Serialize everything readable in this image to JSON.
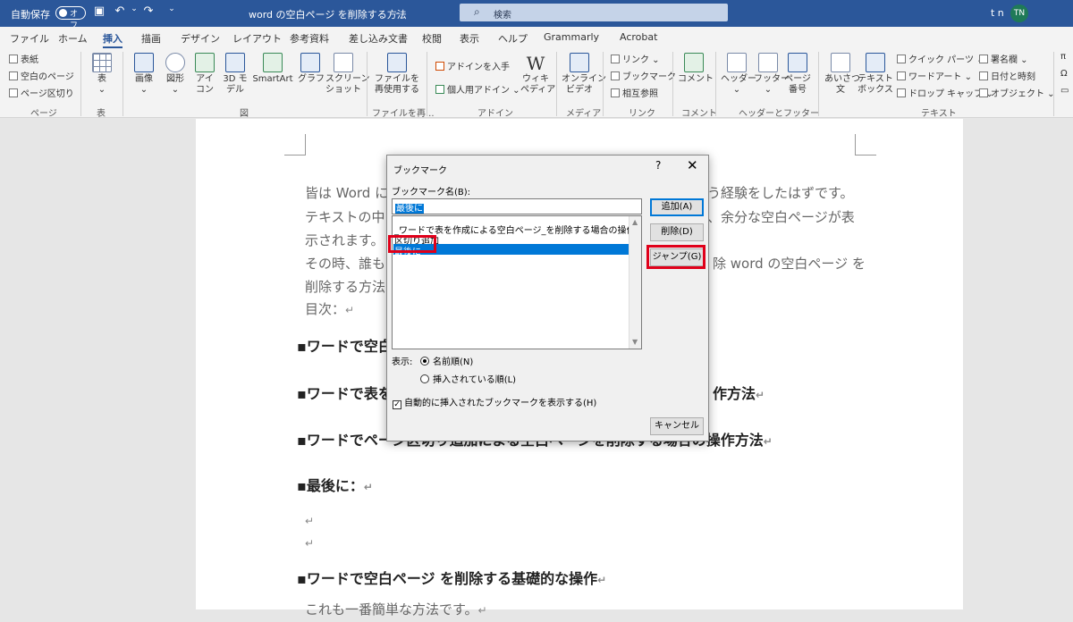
{
  "titlebar": {
    "autosave_label": "自動保存",
    "autosave_state": "オフ",
    "doc_title": "word の空白ページ を削除する方法 ",
    "title_sep": "–",
    "search_placeholder": "検索",
    "user_initials": "t n",
    "avatar": "TN"
  },
  "tabs": [
    "ファイル",
    "ホーム",
    "挿入",
    "描画",
    "デザイン",
    "レイアウト",
    "参考資料",
    "差し込み文書",
    "校閲",
    "表示",
    "ヘルプ",
    "Grammarly",
    "Acrobat"
  ],
  "ribbon": {
    "page": {
      "cover": "表紙",
      "blank": "空白のページ",
      "break": "ページ区切り",
      "group": "ページ"
    },
    "table": {
      "label": "表",
      "group": "表"
    },
    "illustrations": {
      "pictures": "画像",
      "shapes": "図形",
      "icons_1": "アイ",
      "icons_2": "コン",
      "model_1": "3D モ",
      "model_2": "デル",
      "smartart": "SmartArt",
      "chart": "グラフ",
      "screenshot_1": "スクリーン",
      "screenshot_2": "ショット",
      "group": "図"
    },
    "reuse": {
      "label_1": "ファイルを",
      "label_2": "再使用する",
      "group": "ファイルを再..."
    },
    "addins": {
      "get": "アドインを入手",
      "personal": "個人用アドイン",
      "wiki_1": "ウィキ",
      "wiki_2": "ペディア",
      "group": "アドイン"
    },
    "media": {
      "video_1": "オンライン",
      "video_2": "ビデオ",
      "group": "メディア"
    },
    "links": {
      "link": "リンク",
      "bookmark": "ブックマーク",
      "xref": "相互参照",
      "group": "リンク"
    },
    "comments": {
      "comment": "コメント",
      "group": "コメント"
    },
    "header_footer": {
      "header": "ヘッダー",
      "footer": "フッター",
      "pagenum_1": "ページ",
      "pagenum_2": "番号",
      "group": "ヘッダーとフッター"
    },
    "text": {
      "greeting_1": "あいさつ",
      "greeting_2": "文",
      "textbox_1": "テキスト",
      "textbox_2": "ボックス",
      "quickparts": "クイック パーツ",
      "wordart": "ワードアート",
      "dropcap": "ドロップ キャップ",
      "signature": "署名欄",
      "datetime": "日付と時刻",
      "object": "オブジェクト",
      "group": "テキスト"
    }
  },
  "document": {
    "para1": "皆は Word に",
    "para1_end": "う経験をしたはずです。",
    "para2": "テキストの中",
    "para2_end": "、余分な空白ページが表",
    "para3": "示されます。",
    "para4": "その時、誰も",
    "para4_end": "除 word の空白ページ を",
    "para5": "削除する方法",
    "toc": "目次：",
    "h1": "▪ワードで空白",
    "h2": "▪ワードで表を",
    "h2_end": "作方法",
    "h3": "▪ワードでページ区切り追加による空白ページを削除する場合の操作方法",
    "h4": "▪最後に：",
    "h5": "▪ワードで空白ページ を削除する基礎的な操作",
    "para_last": "これも一番簡単な方法です。",
    "return_mark": "↵"
  },
  "dialog": {
    "title": "ブックマーク",
    "help": "?",
    "close": "✕",
    "name_label": "ブックマーク名(B):",
    "name_value": "最後に",
    "items": [
      "_ワードで表を作成による空白ページ_を削除する場合の操作方法",
      "区切り追加",
      "最後に"
    ],
    "buttons": {
      "add": "追加(A)",
      "delete": "削除(D)",
      "jump": "ジャンプ(G)",
      "cancel": "キャンセル"
    },
    "show_label": "表示:",
    "sort_by_name": "名前順(N)",
    "sort_by_location": "挿入されている順(L)",
    "hidden_checkbox": "自動的に挿入されたブックマークを表示する(H)"
  }
}
